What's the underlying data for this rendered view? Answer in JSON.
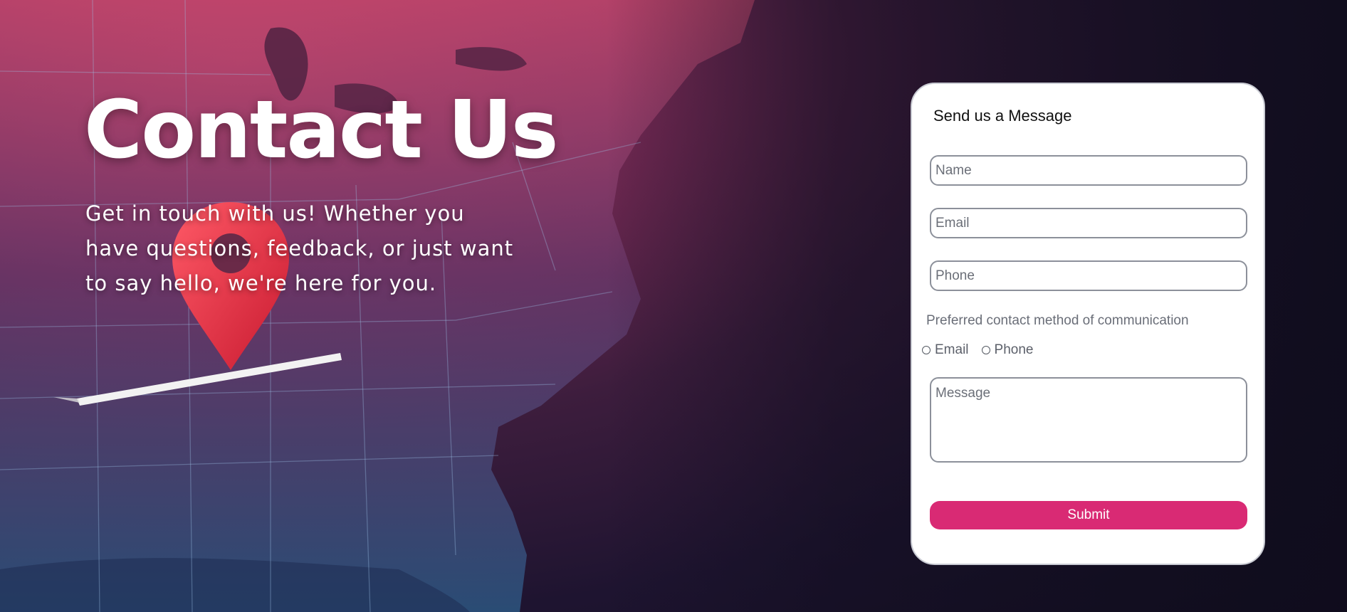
{
  "hero": {
    "title": "Contact Us",
    "subtitle": "Get in touch with us! Whether you have questions, feedback, or just want to say hello, we're here for you."
  },
  "background": {
    "map_icon": "map-pin-icon",
    "colors": {
      "top_left": "#b0395f",
      "bottom_left": "#2b4d78",
      "dark": "#130f22",
      "pin": "#e8283c"
    }
  },
  "form": {
    "heading": "Send us a Message",
    "name_placeholder": "Name",
    "email_placeholder": "Email",
    "phone_placeholder": "Phone",
    "preference_label": "Preferred contact method of communication",
    "radio_options": [
      {
        "label": "Email"
      },
      {
        "label": "Phone"
      }
    ],
    "message_placeholder": "Message",
    "submit_label": "Submit",
    "accent_color": "#d92a74"
  }
}
